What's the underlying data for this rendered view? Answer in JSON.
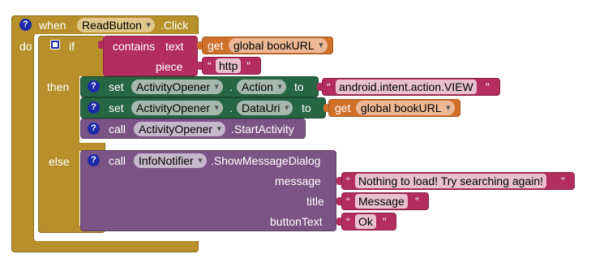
{
  "event": {
    "when": "when",
    "component": "ReadButton",
    "event_name": ".Click",
    "do": "do"
  },
  "if_block": {
    "if": "if",
    "then": "then",
    "else": "else",
    "condition": {
      "contains": "contains",
      "text": "text",
      "piece": "piece",
      "get": "get",
      "variable": "global bookURL",
      "piece_value": "http"
    }
  },
  "then_blocks": [
    {
      "set": "set",
      "component": "ActivityOpener",
      "property": "Action",
      "to": "to",
      "value": "android.intent.action.VIEW"
    },
    {
      "set": "set",
      "component": "ActivityOpener",
      "property": "DataUri",
      "to": "to",
      "get": "get",
      "variable": "global bookURL"
    },
    {
      "call": "call",
      "component": "ActivityOpener",
      "method": ".StartActivity"
    }
  ],
  "else_block": {
    "call": "call",
    "component": "InfoNotifier",
    "method": ".ShowMessageDialog",
    "params": [
      {
        "name": "message",
        "value": "Nothing to load! Try searching again!"
      },
      {
        "name": "title",
        "value": "Message"
      },
      {
        "name": "buttonText",
        "value": "Ok"
      }
    ]
  },
  "icons": {
    "help": "?",
    "quote_open": "“",
    "quote_close": "”"
  },
  "colors": {
    "event": "#b7902b",
    "text": "#b32d5e",
    "variable": "#d0712a",
    "setter": "#266643",
    "call": "#7c5385"
  }
}
